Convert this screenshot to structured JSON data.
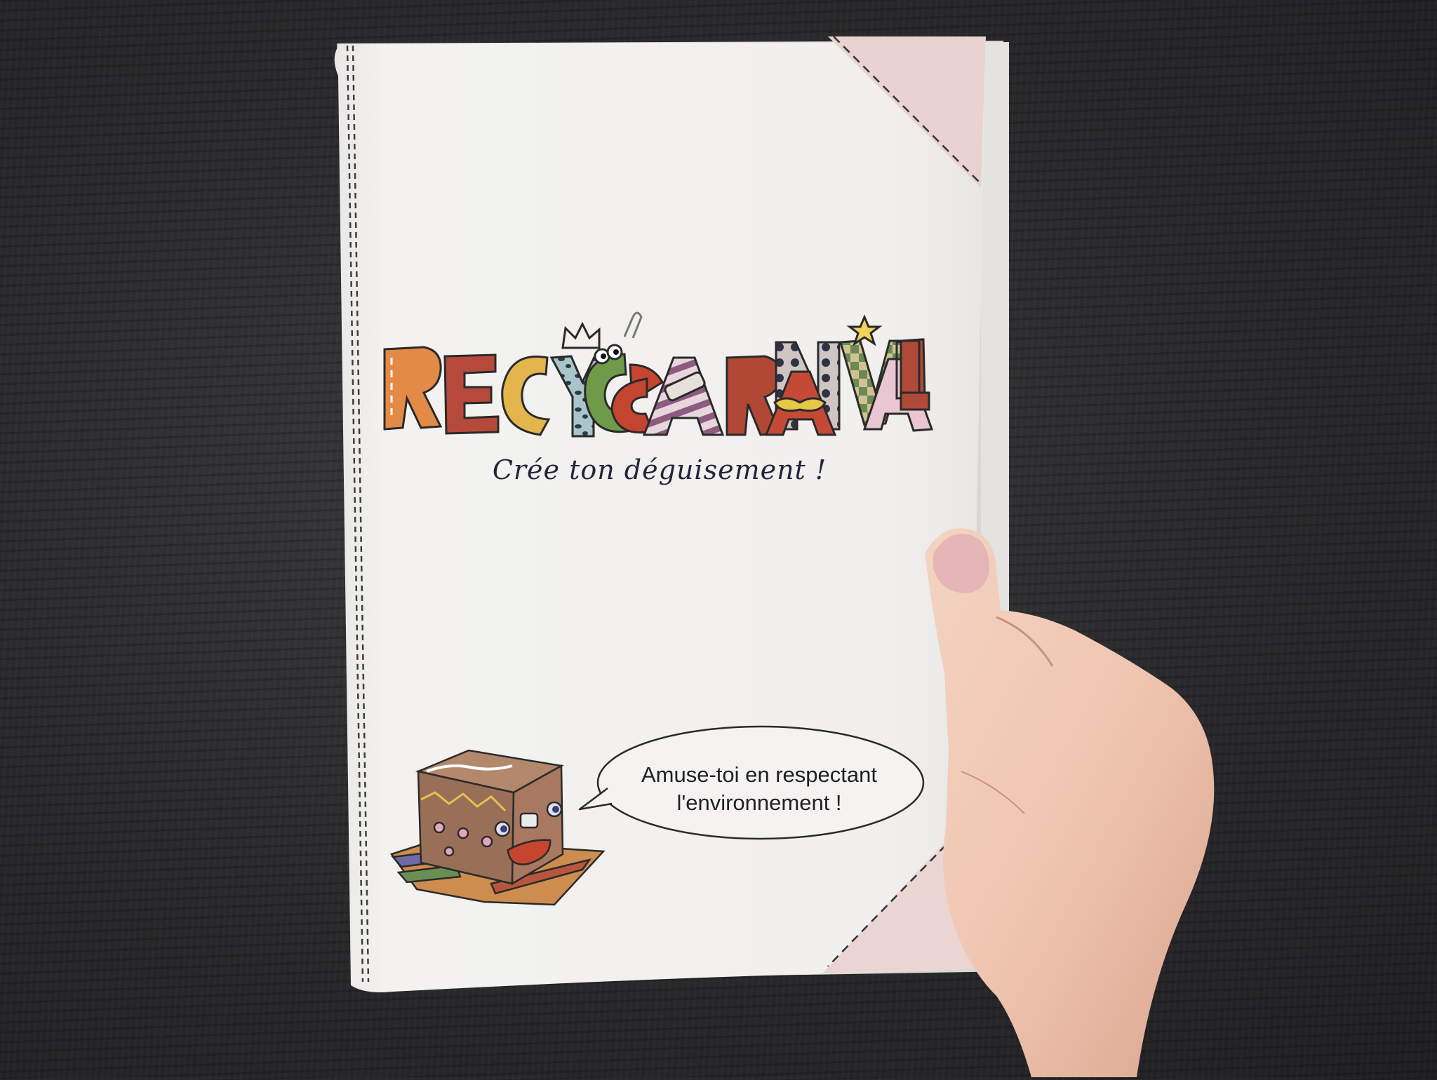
{
  "booklet": {
    "title_letters": [
      "R",
      "E",
      "C",
      "Y",
      "C",
      "A",
      "R",
      "N",
      "A",
      "V",
      "A",
      "L"
    ],
    "subtitle": "Crée ton déguisement !",
    "speech": {
      "line1": "Amuse-toi en respectant",
      "line2": "l'environnement !"
    }
  },
  "colors": {
    "background": "#2b2b2d",
    "paper": "#f1f0ee",
    "corner": "#e9d6d3",
    "text": "#23243a"
  }
}
